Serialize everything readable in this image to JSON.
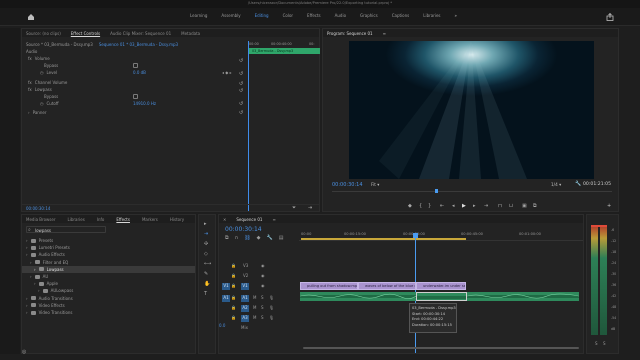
{
  "title": "/Users/nicerazor/Documents/Adobe/Premiere Pro/22.0/Exporting tutorial.prproj *",
  "workspaces": [
    "Learning",
    "Assembly",
    "Editing",
    "Color",
    "Effects",
    "Audio",
    "Graphics",
    "Captions",
    "Libraries"
  ],
  "workspace_active": "Editing",
  "source_panel": {
    "tabs": [
      "Source: (no clips)",
      "Effect Controls",
      "Audio Clip Mixer: Sequence 01",
      "Metadata"
    ],
    "active": "Effect Controls",
    "crumb_a": "Source * 03_Bermuda - Dssy.mp3",
    "crumb_b": "Sequence 01 * 03_Bermuda - Dssy.mp3",
    "tc_start": "00:00",
    "tc_mid": "00:00:40:00",
    "tc_end": "00:",
    "clip_label": "03_Bermuda - Dssy.mp3",
    "section_audio": "Audio",
    "volume": "Volume",
    "bypass": "Bypass",
    "level": "Level",
    "level_val": "0.0 dB",
    "channel_volume": "Channel Volume",
    "lowpass": "Lowpass",
    "bypass2": "Bypass",
    "cutoff": "Cutoff",
    "cutoff_val": "14910.0 Hz",
    "panner": "Panner",
    "bottom_tc": "00:00:30:14"
  },
  "program": {
    "title": "Program: Sequence 01",
    "timecode": "00:00:30:14",
    "fit": "Fit",
    "scale": "1/4",
    "duration": "00:01:21:05"
  },
  "project": {
    "tabs": [
      "Media Browser",
      "Libraries",
      "Info",
      "Effects",
      "Markers",
      "History"
    ],
    "active": "Effects",
    "search": "lowpass",
    "tree": [
      {
        "label": "Presets",
        "indent": 1,
        "sel": false
      },
      {
        "label": "Lumetri Presets",
        "indent": 1,
        "sel": false
      },
      {
        "label": "Audio Effects",
        "indent": 1,
        "sel": false
      },
      {
        "label": "Filter and EQ",
        "indent": 2,
        "sel": false
      },
      {
        "label": "Lowpass",
        "indent": 3,
        "sel": true
      },
      {
        "label": "AU",
        "indent": 2,
        "sel": false
      },
      {
        "label": "Apple",
        "indent": 3,
        "sel": false
      },
      {
        "label": "AULowpass",
        "indent": 4,
        "sel": false
      },
      {
        "label": "Audio Transitions",
        "indent": 1,
        "sel": false
      },
      {
        "label": "Video Effects",
        "indent": 1,
        "sel": false
      },
      {
        "label": "Video Transitions",
        "indent": 1,
        "sel": false
      }
    ]
  },
  "timeline": {
    "tab": "Sequence 01",
    "timecode": "00:00:30:14",
    "ruler": [
      "00:00",
      "00:00:15:00",
      "00:00:30:00",
      "00:00:45:00",
      "00:01:00:00"
    ],
    "video_tracks": [
      "V3",
      "V2",
      "V1"
    ],
    "audio_tracks": [
      "A1",
      "A2",
      "A3"
    ],
    "mix": "Mix",
    "mix_val": "0.0",
    "clips": [
      "pulling out from shadow.mp4 [V]",
      "waves of below of the blue ocean",
      "underwater.im under seacable.mp4"
    ],
    "tooltip": {
      "name": "03_Bermuda - Dssy.mp3",
      "start": "Start: 00:00:30:14",
      "end": "End: 00:00:44:22",
      "duration": "Duration: 00:00:15:15"
    },
    "meter_labels": [
      "-6",
      "-12",
      "-18",
      "-24",
      "-30",
      "-36",
      "-42",
      "-48",
      "-54",
      "dB"
    ],
    "meter_s": "S"
  },
  "colors": {
    "accent": "#3f8cea",
    "playhead": "#4a9bf0",
    "clip_video": "#a993cf",
    "clip_audio": "#2e8a5c",
    "label_green": "#24b55a"
  }
}
